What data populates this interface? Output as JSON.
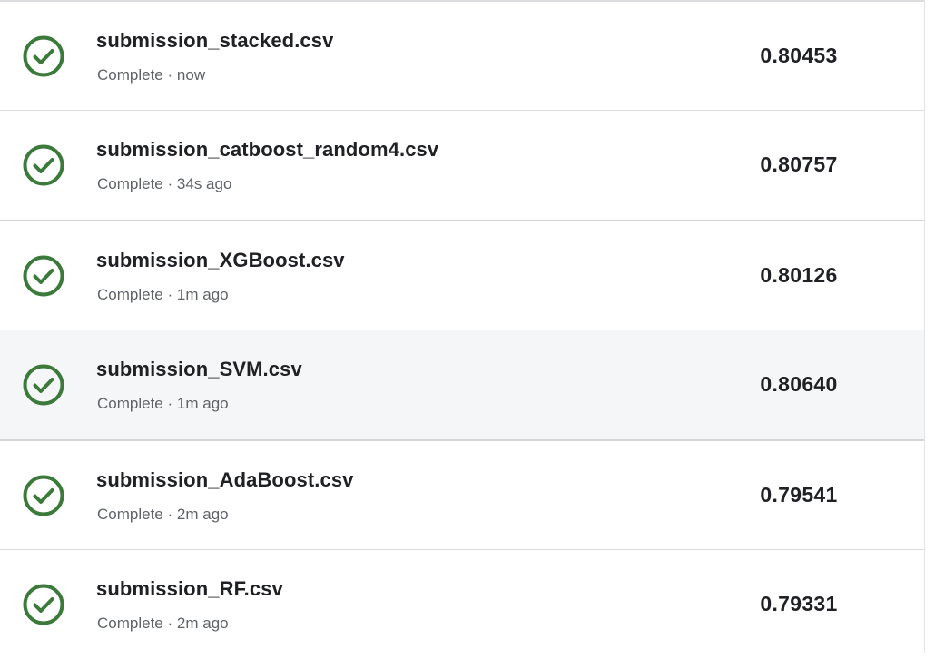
{
  "colors": {
    "success_green": "#3b7a3b",
    "text_primary": "#202124",
    "text_secondary": "#5f6368",
    "row_hover_bg": "#f5f6f7",
    "divider": "#dadce0"
  },
  "icons": {
    "status": "check-circle-icon"
  },
  "submissions": [
    {
      "filename": "submission_stacked.csv",
      "status": "Complete",
      "separator": "·",
      "time": "now",
      "score": "0.80453"
    },
    {
      "filename": "submission_catboost_random4.csv",
      "status": "Complete",
      "separator": "·",
      "time": "34s ago",
      "score": "0.80757"
    },
    {
      "filename": "submission_XGBoost.csv",
      "status": "Complete",
      "separator": "·",
      "time": "1m ago",
      "score": "0.80126"
    },
    {
      "filename": "submission_SVM.csv",
      "status": "Complete",
      "separator": "·",
      "time": "1m ago",
      "score": "0.80640"
    },
    {
      "filename": "submission_AdaBoost.csv",
      "status": "Complete",
      "separator": "·",
      "time": "2m ago",
      "score": "0.79541"
    },
    {
      "filename": "submission_RF.csv",
      "status": "Complete",
      "separator": "·",
      "time": "2m ago",
      "score": "0.79331"
    }
  ]
}
